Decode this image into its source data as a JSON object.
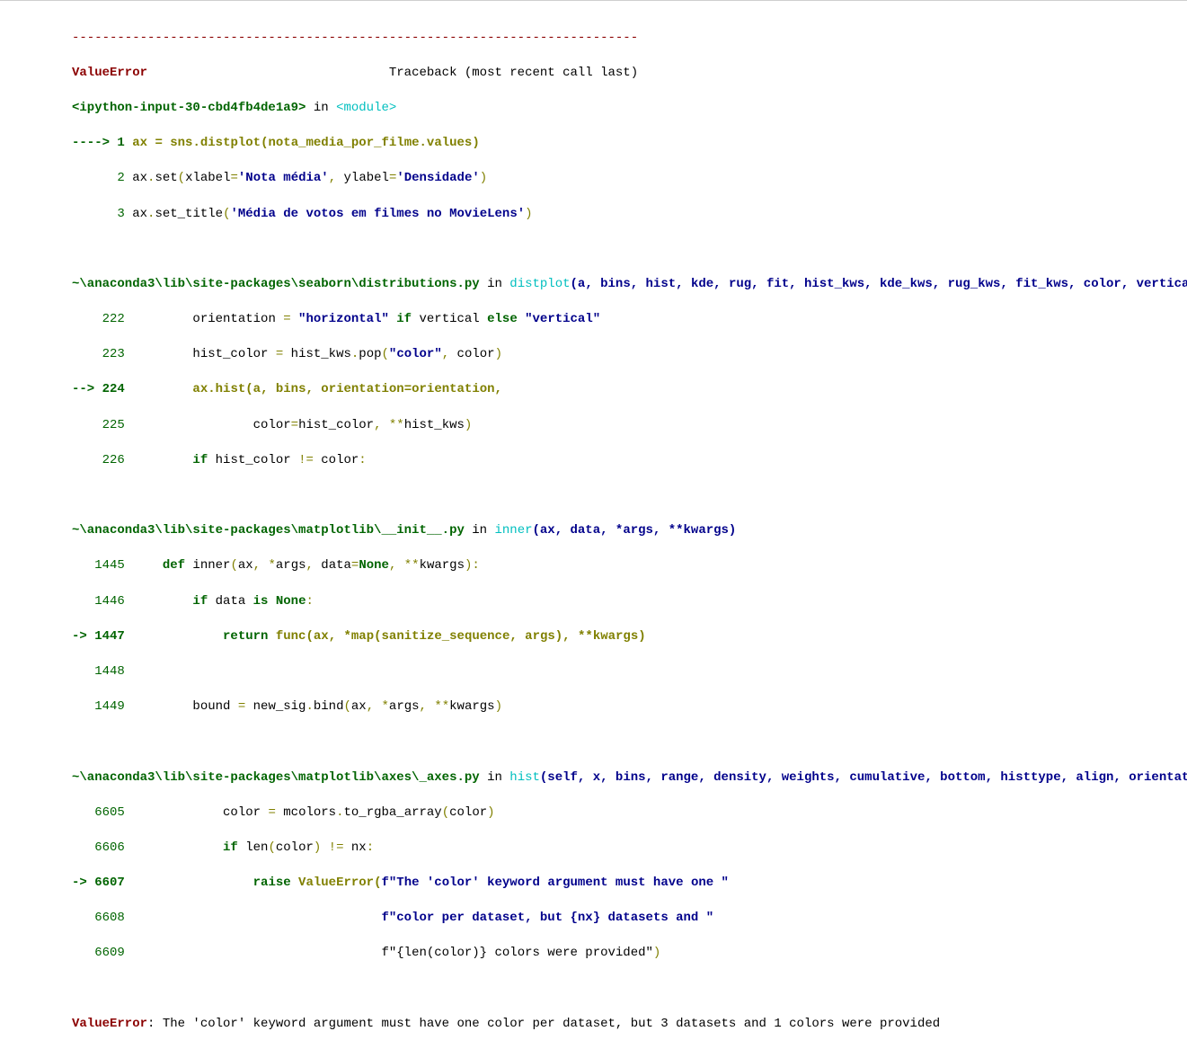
{
  "sep": "---------------------------------------------------------------------------",
  "err_name": "ValueError",
  "tb_label": "Traceback (most recent call last)",
  "cell_ref": "<ipython-input-30-cbd4fb4de1a9>",
  "in_word": " in ",
  "module_tag": "<module>",
  "cell_l1_arrow": "----> 1 ",
  "cell_l1_a": "ax ",
  "cell_l1_b": "=",
  "cell_l1_c": " sns",
  "cell_l1_d": ".",
  "cell_l1_e": "distplot",
  "cell_l1_f": "(",
  "cell_l1_g": "nota_media_por_filme",
  "cell_l1_h": ".",
  "cell_l1_i": "values",
  "cell_l1_j": ")",
  "cell_l2_num": "      2 ",
  "cell_l2_a": "ax",
  "cell_l2_b": ".",
  "cell_l2_c": "set",
  "cell_l2_d": "(",
  "cell_l2_e": "xlabel",
  "cell_l2_f": "=",
  "cell_l2_g": "'Nota média'",
  "cell_l2_h": ",",
  "cell_l2_i": " ylabel",
  "cell_l2_j": "=",
  "cell_l2_k": "'Densidade'",
  "cell_l2_l": ")",
  "cell_l3_num": "      3 ",
  "cell_l3_a": "ax",
  "cell_l3_b": ".",
  "cell_l3_c": "set_title",
  "cell_l3_d": "(",
  "cell_l3_e": "'Média de votos em filmes no MovieLens'",
  "cell_l3_f": ")",
  "f1_path": "~\\anaconda3\\lib\\site-packages\\seaborn\\distributions.py",
  "f1_func": "distplot",
  "f1_sig": "(a, bins, hist, kde, rug, fit, hist_kws, kde_kws, rug_kws, fit_kws, color, vertical, norm_hist, axlabel, label, ax)",
  "f1_l222_n": "    222 ",
  "f1_l222_a": "        orientation ",
  "f1_l222_b": "=",
  "f1_l222_c": " \"horizontal\"",
  "f1_l222_d": " if",
  "f1_l222_e": " vertical ",
  "f1_l222_f": "else",
  "f1_l222_g": " \"vertical\"",
  "f1_l223_n": "    223 ",
  "f1_l223_a": "        hist_color ",
  "f1_l223_b": "=",
  "f1_l223_c": " hist_kws",
  "f1_l223_d": ".",
  "f1_l223_e": "pop",
  "f1_l223_f": "(",
  "f1_l223_g": "\"color\"",
  "f1_l223_h": ",",
  "f1_l223_i": " color",
  "f1_l223_j": ")",
  "f1_l224_arrow": "--> 224 ",
  "f1_l224_a": "        ax",
  "f1_l224_b": ".",
  "f1_l224_c": "hist",
  "f1_l224_d": "(",
  "f1_l224_e": "a",
  "f1_l224_f": ",",
  "f1_l224_g": " bins",
  "f1_l224_h": ",",
  "f1_l224_i": " orientation",
  "f1_l224_j": "=",
  "f1_l224_k": "orientation",
  "f1_l224_l": ",",
  "f1_l225_n": "    225 ",
  "f1_l225_a": "                color",
  "f1_l225_b": "=",
  "f1_l225_c": "hist_color",
  "f1_l225_d": ",",
  "f1_l225_e": " **",
  "f1_l225_f": "hist_kws",
  "f1_l225_g": ")",
  "f1_l226_n": "    226 ",
  "f1_l226_a": "        if",
  "f1_l226_b": " hist_color ",
  "f1_l226_c": "!=",
  "f1_l226_d": " color",
  "f1_l226_e": ":",
  "f2_path": "~\\anaconda3\\lib\\site-packages\\matplotlib\\__init__.py",
  "f2_func": "inner",
  "f2_sig": "(ax, data, *args, **kwargs)",
  "f2_l1445_n": "   1445 ",
  "f2_l1445_a": "    def",
  "f2_l1445_b": " inner",
  "f2_l1445_c": "(",
  "f2_l1445_d": "ax",
  "f2_l1445_e": ",",
  "f2_l1445_f": " *",
  "f2_l1445_g": "args",
  "f2_l1445_h": ",",
  "f2_l1445_i": " data",
  "f2_l1445_j": "=",
  "f2_l1445_k": "None",
  "f2_l1445_l": ",",
  "f2_l1445_m": " **",
  "f2_l1445_n2": "kwargs",
  "f2_l1445_o": "):",
  "f2_l1446_n": "   1446 ",
  "f2_l1446_a": "        if",
  "f2_l1446_b": " data ",
  "f2_l1446_c": "is",
  "f2_l1446_d": " None",
  "f2_l1446_e": ":",
  "f2_l1447_arrow": "-> 1447 ",
  "f2_l1447_a": "            return",
  "f2_l1447_b": " func",
  "f2_l1447_c": "(",
  "f2_l1447_d": "ax",
  "f2_l1447_e": ",",
  "f2_l1447_f": " *",
  "f2_l1447_g": "map",
  "f2_l1447_h": "(",
  "f2_l1447_i": "sanitize_sequence",
  "f2_l1447_j": ",",
  "f2_l1447_k": " args",
  "f2_l1447_l": "),",
  "f2_l1447_m": " **",
  "f2_l1447_n2": "kwargs",
  "f2_l1447_o": ")",
  "f2_l1448_n": "   1448 ",
  "f2_l1449_n": "   1449 ",
  "f2_l1449_a": "        bound ",
  "f2_l1449_b": "=",
  "f2_l1449_c": " new_sig",
  "f2_l1449_d": ".",
  "f2_l1449_e": "bind",
  "f2_l1449_f": "(",
  "f2_l1449_g": "ax",
  "f2_l1449_h": ",",
  "f2_l1449_i": " *",
  "f2_l1449_j": "args",
  "f2_l1449_k": ",",
  "f2_l1449_l": " **",
  "f2_l1449_m": "kwargs",
  "f2_l1449_n2": ")",
  "f3_path": "~\\anaconda3\\lib\\site-packages\\matplotlib\\axes\\_axes.py",
  "f3_func": "hist",
  "f3_sig": "(self, x, bins, range, density, weights, cumulative, bottom, histtype, align, orientation, rwidth, log, color, label, stacked, **kwargs)",
  "f3_l6605_n": "   6605 ",
  "f3_l6605_a": "            color ",
  "f3_l6605_b": "=",
  "f3_l6605_c": " mcolors",
  "f3_l6605_d": ".",
  "f3_l6605_e": "to_rgba_array",
  "f3_l6605_f": "(",
  "f3_l6605_g": "color",
  "f3_l6605_h": ")",
  "f3_l6606_n": "   6606 ",
  "f3_l6606_a": "            if",
  "f3_l6606_b": " len",
  "f3_l6606_c": "(",
  "f3_l6606_d": "color",
  "f3_l6606_e": ")",
  "f3_l6606_f": " !=",
  "f3_l6606_g": " nx",
  "f3_l6606_h": ":",
  "f3_l6607_arrow": "-> 6607 ",
  "f3_l6607_a": "                raise",
  "f3_l6607_b": " ValueError",
  "f3_l6607_c": "(",
  "f3_l6607_d": "f\"The 'color' keyword argument must have one \"",
  "f3_l6608_n": "   6608 ",
  "f3_l6608_a": "                                 f\"color per dataset, but {nx} datasets and \"",
  "f3_l6609_n": "   6609 ",
  "f3_l6609_a": "                                 f\"{len(color)} colors were provided\"",
  "f3_l6609_b": ")",
  "final_err": "ValueError",
  "final_msg": ": The 'color' keyword argument must have one color per dataset, but 3 datasets and 1 colors were provided",
  "pad_tb": "                                "
}
